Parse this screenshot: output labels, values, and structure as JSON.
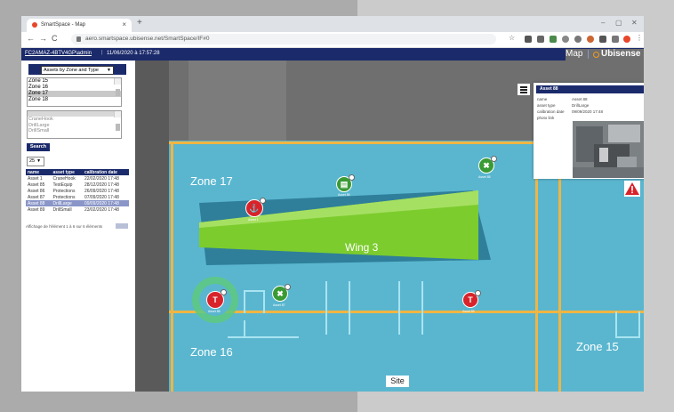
{
  "browser": {
    "tab_title": "SmartSpace - Map",
    "url": "aero.smartspace.ubisense.net/SmartSpace/IF#0"
  },
  "app": {
    "user": "FC2AMAZ-4BTV4GP\\admin",
    "datetime": "11/06/2020 à 17:57:28",
    "page_title": "Map",
    "brand": "Ubisense"
  },
  "panel": {
    "filter_select": "Assets by Zone and Type",
    "zones": [
      "Zone 15",
      "Zone 16",
      "Zone 17",
      "Zone 18"
    ],
    "selected_zone": "Zone 17",
    "types": [
      "CraneHook",
      "DrillLarge",
      "DrillSmall"
    ],
    "search_label": "Search",
    "page_size": "25",
    "table": {
      "headers": [
        "name",
        "asset type",
        "calibration date"
      ],
      "rows": [
        [
          "Asset 1",
          "CraneHook",
          "22/02/2020 17:48"
        ],
        [
          "Asset 85",
          "TestEquip",
          "28/12/2020 17:48"
        ],
        [
          "Asset 86",
          "Protections",
          "26/09/2020 17:48"
        ],
        [
          "Asset 87",
          "Protections",
          "07/09/2020 17:48"
        ],
        [
          "Asset 88",
          "DrillLarge",
          "09/09/2020 17:48"
        ],
        [
          "Asset 89",
          "DrillSmall",
          "23/02/2020 17:48"
        ]
      ],
      "selected_row": 4
    },
    "info_text": "Affichage de l'élément 1 à 6 sur 6 éléments"
  },
  "map": {
    "zones": [
      "Zone 17",
      "Zone 16",
      "Zone 15"
    ],
    "wing_label": "Wing 3",
    "site_label": "Site",
    "markers": [
      {
        "label": "Asset 1",
        "color": "#d8232a",
        "symbol": "hook-icon"
      },
      {
        "label": "Asset 86",
        "color": "#3a9a34",
        "symbol": "vest-icon"
      },
      {
        "label": "Asset 85",
        "color": "#3a9a34",
        "symbol": "tool-icon"
      },
      {
        "label": "Asset 88",
        "color": "#d8232a",
        "symbol": "drill-icon"
      },
      {
        "label": "Asset 87",
        "color": "#3a9a34",
        "symbol": "tool-icon"
      },
      {
        "label": "Asset 89",
        "color": "#d8232a",
        "symbol": "drill-icon"
      }
    ],
    "popup": {
      "title": "Asset 88",
      "rows": [
        {
          "k": "name",
          "v": "Asset 88"
        },
        {
          "k": "asset type",
          "v": "DrillLarge"
        },
        {
          "k": "calibration date",
          "v": "09/09/2020 17:48"
        },
        {
          "k": "photo link",
          "v": ""
        }
      ]
    }
  },
  "colors": {
    "header": "#1b2a6b",
    "floor": "#5ab6cf",
    "zone_border": "#f0b542",
    "wing_green": "#7ccc2e",
    "alert_red": "#d8232a"
  }
}
